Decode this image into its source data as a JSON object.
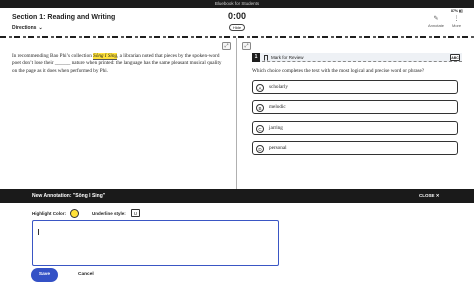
{
  "window": {
    "title": "Bluebook for Students"
  },
  "header": {
    "section_title": "Section 1: Reading and Writing",
    "directions_label": "Directions",
    "timer": "0:00",
    "hide_label": "Hide",
    "status": "87% ▮▯",
    "annotate_label": "Annotate",
    "more_label": "More"
  },
  "passage": {
    "before": "In recommending Bao Phi’s collection ",
    "highlight": "Sông I Sing",
    "after": ", a librarian noted that pieces by the spoken-word poet don’t lose their ______ nature when printed: the language has the same pleasant musical quality on the page as it does when performed by Phi."
  },
  "question": {
    "number": "1",
    "mark_label": "Mark for Review",
    "abc_label": "ABC",
    "prompt": "Which choice completes the text with the most logical and precise word or phrase?",
    "choices": [
      {
        "letter": "A",
        "text": "scholarly"
      },
      {
        "letter": "B",
        "text": "melodic"
      },
      {
        "letter": "C",
        "text": "jarring"
      },
      {
        "letter": "D",
        "text": "personal"
      }
    ]
  },
  "annotation": {
    "title": "New Annotation: \"Sông I Sing\"",
    "close_label": "CLOSE ✕",
    "highlight_color_label": "Highlight Color:",
    "highlight_color": "#ffe13a",
    "underline_label": "Underline style:",
    "underline_value": "U",
    "note_value": "",
    "save_label": "Save",
    "cancel_label": "Cancel"
  }
}
